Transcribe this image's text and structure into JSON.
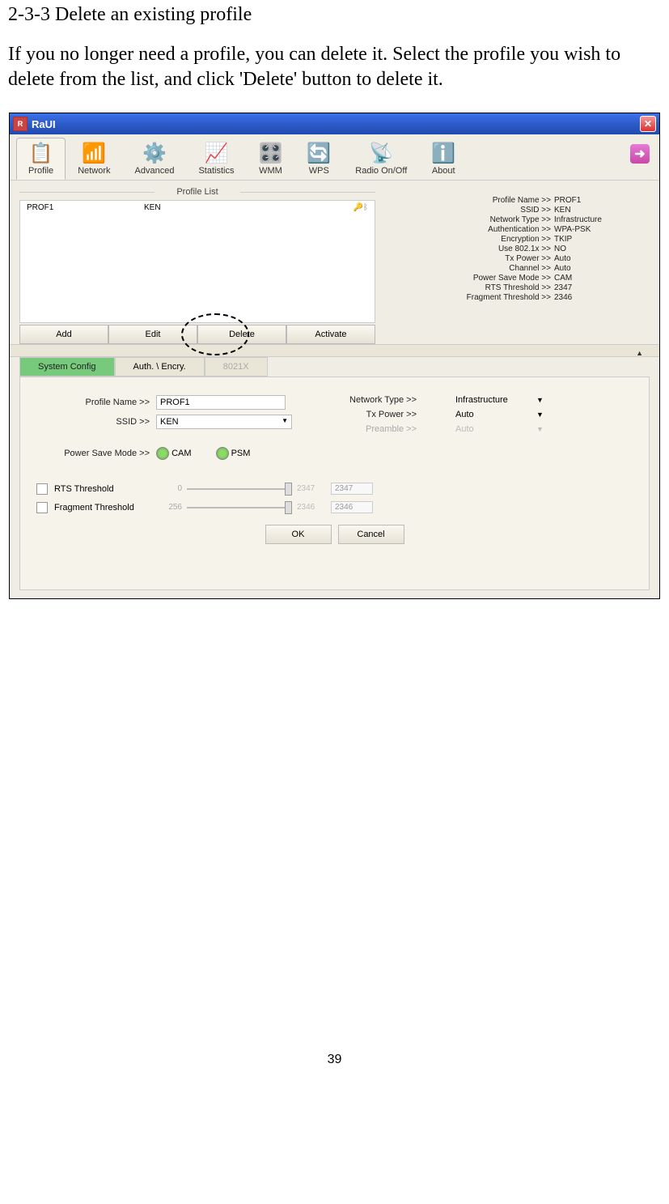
{
  "doc": {
    "heading": "2-3-3 Delete an existing profile",
    "body": "If you no longer need a profile, you can delete it. Select the profile you wish to delete from the list, and click 'Delete' button to delete it.",
    "page_num": "39"
  },
  "window": {
    "title": "RaUI"
  },
  "toolbar": [
    {
      "label": "Profile"
    },
    {
      "label": "Network"
    },
    {
      "label": "Advanced"
    },
    {
      "label": "Statistics"
    },
    {
      "label": "WMM"
    },
    {
      "label": "WPS"
    },
    {
      "label": "Radio On/Off"
    },
    {
      "label": "About"
    }
  ],
  "profile_list": {
    "title": "Profile List",
    "rows": [
      {
        "name": "PROF1",
        "ssid": "KEN"
      }
    ],
    "buttons": {
      "add": "Add",
      "edit": "Edit",
      "delete": "Delete",
      "activate": "Activate"
    }
  },
  "details": {
    "profile_name": {
      "label": "Profile Name >>",
      "value": "PROF1"
    },
    "ssid": {
      "label": "SSID >>",
      "value": "KEN"
    },
    "network_type": {
      "label": "Network Type >>",
      "value": "Infrastructure"
    },
    "auth": {
      "label": "Authentication >>",
      "value": "WPA-PSK"
    },
    "encryption": {
      "label": "Encryption >>",
      "value": "TKIP"
    },
    "use8021x": {
      "label": "Use 802.1x >>",
      "value": "NO"
    },
    "txpower": {
      "label": "Tx Power >>",
      "value": "Auto"
    },
    "channel": {
      "label": "Channel >>",
      "value": "Auto"
    },
    "psm": {
      "label": "Power Save Mode >>",
      "value": "CAM"
    },
    "rts": {
      "label": "RTS Threshold >>",
      "value": "2347"
    },
    "frag": {
      "label": "Fragment Threshold >>",
      "value": "2346"
    }
  },
  "tabs": {
    "sys": "System Config",
    "auth": "Auth. \\ Encry.",
    "x": "8021X"
  },
  "config": {
    "profile_name": {
      "label": "Profile Name >>",
      "value": "PROF1"
    },
    "ssid": {
      "label": "SSID >>",
      "value": "KEN"
    },
    "psm": {
      "label": "Power Save Mode >>",
      "cam": "CAM",
      "psm": "PSM"
    },
    "network_type": {
      "label": "Network Type >>",
      "value": "Infrastructure"
    },
    "txpower": {
      "label": "Tx Power >>",
      "value": "Auto"
    },
    "preamble": {
      "label": "Preamble >>",
      "value": "Auto"
    },
    "rts": {
      "label": "RTS Threshold",
      "min": "0",
      "max": "2347",
      "value": "2347"
    },
    "frag": {
      "label": "Fragment Threshold",
      "min": "256",
      "max": "2346",
      "value": "2346"
    },
    "ok": "OK",
    "cancel": "Cancel"
  }
}
